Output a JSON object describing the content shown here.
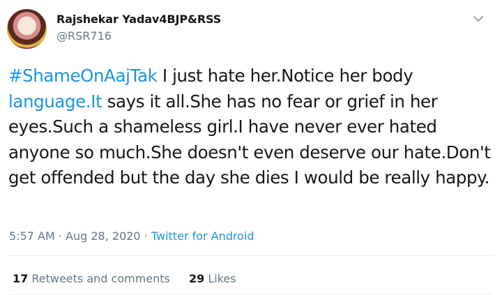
{
  "tweet": {
    "author": {
      "name": "Rajshekar Yadav4BJP&RSS",
      "handle": "@RSR716"
    },
    "hashtag": "#ShameOnAajTak",
    "text_part1": " I just hate her.Notice her body ",
    "link": "language.It",
    "text_part2": " says it all.She has no fear or grief in her eyes.Such a shameless girl.I have never ever hated anyone so much.She doesn't even deserve our hate.Don't get offended but the day she dies I would be really happy.",
    "time": "5:57 AM",
    "date": "Aug 28, 2020",
    "separator": " · ",
    "source": "Twitter for Android",
    "retweets_count": "17",
    "retweets_label": " Retweets and comments",
    "likes_count": "29",
    "likes_label": " Likes"
  },
  "icons": {
    "menu": "chevron-down-icon"
  },
  "colors": {
    "link": "#1b95e0",
    "secondary": "#657786",
    "divider": "#e6ecf0"
  }
}
